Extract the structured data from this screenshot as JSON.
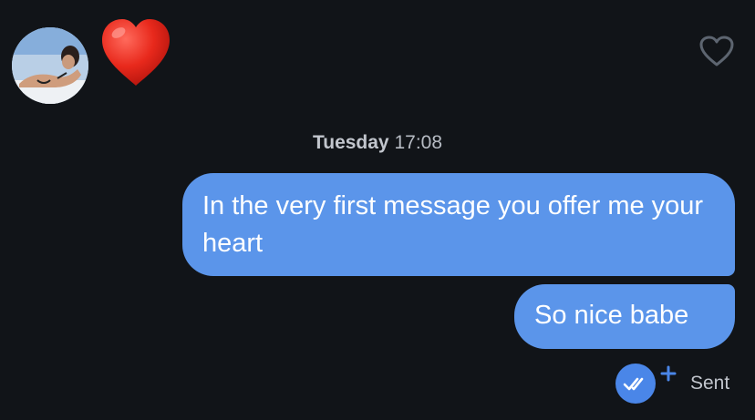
{
  "profile": {
    "avatar_alt": "profile photo"
  },
  "reaction": {
    "emoji_icon": "red-heart-emoji"
  },
  "header": {
    "like_icon": "heart-outline-icon"
  },
  "conversation": {
    "timestamp_day": "Tuesday",
    "timestamp_time": "17:08",
    "messages": [
      {
        "text": "In the very first message you offer me your heart"
      },
      {
        "text": "So nice babe"
      }
    ],
    "status": "Sent"
  },
  "colors": {
    "background": "#111418",
    "bubble": "#5b95ea",
    "receipt_badge": "#4a86e8"
  }
}
